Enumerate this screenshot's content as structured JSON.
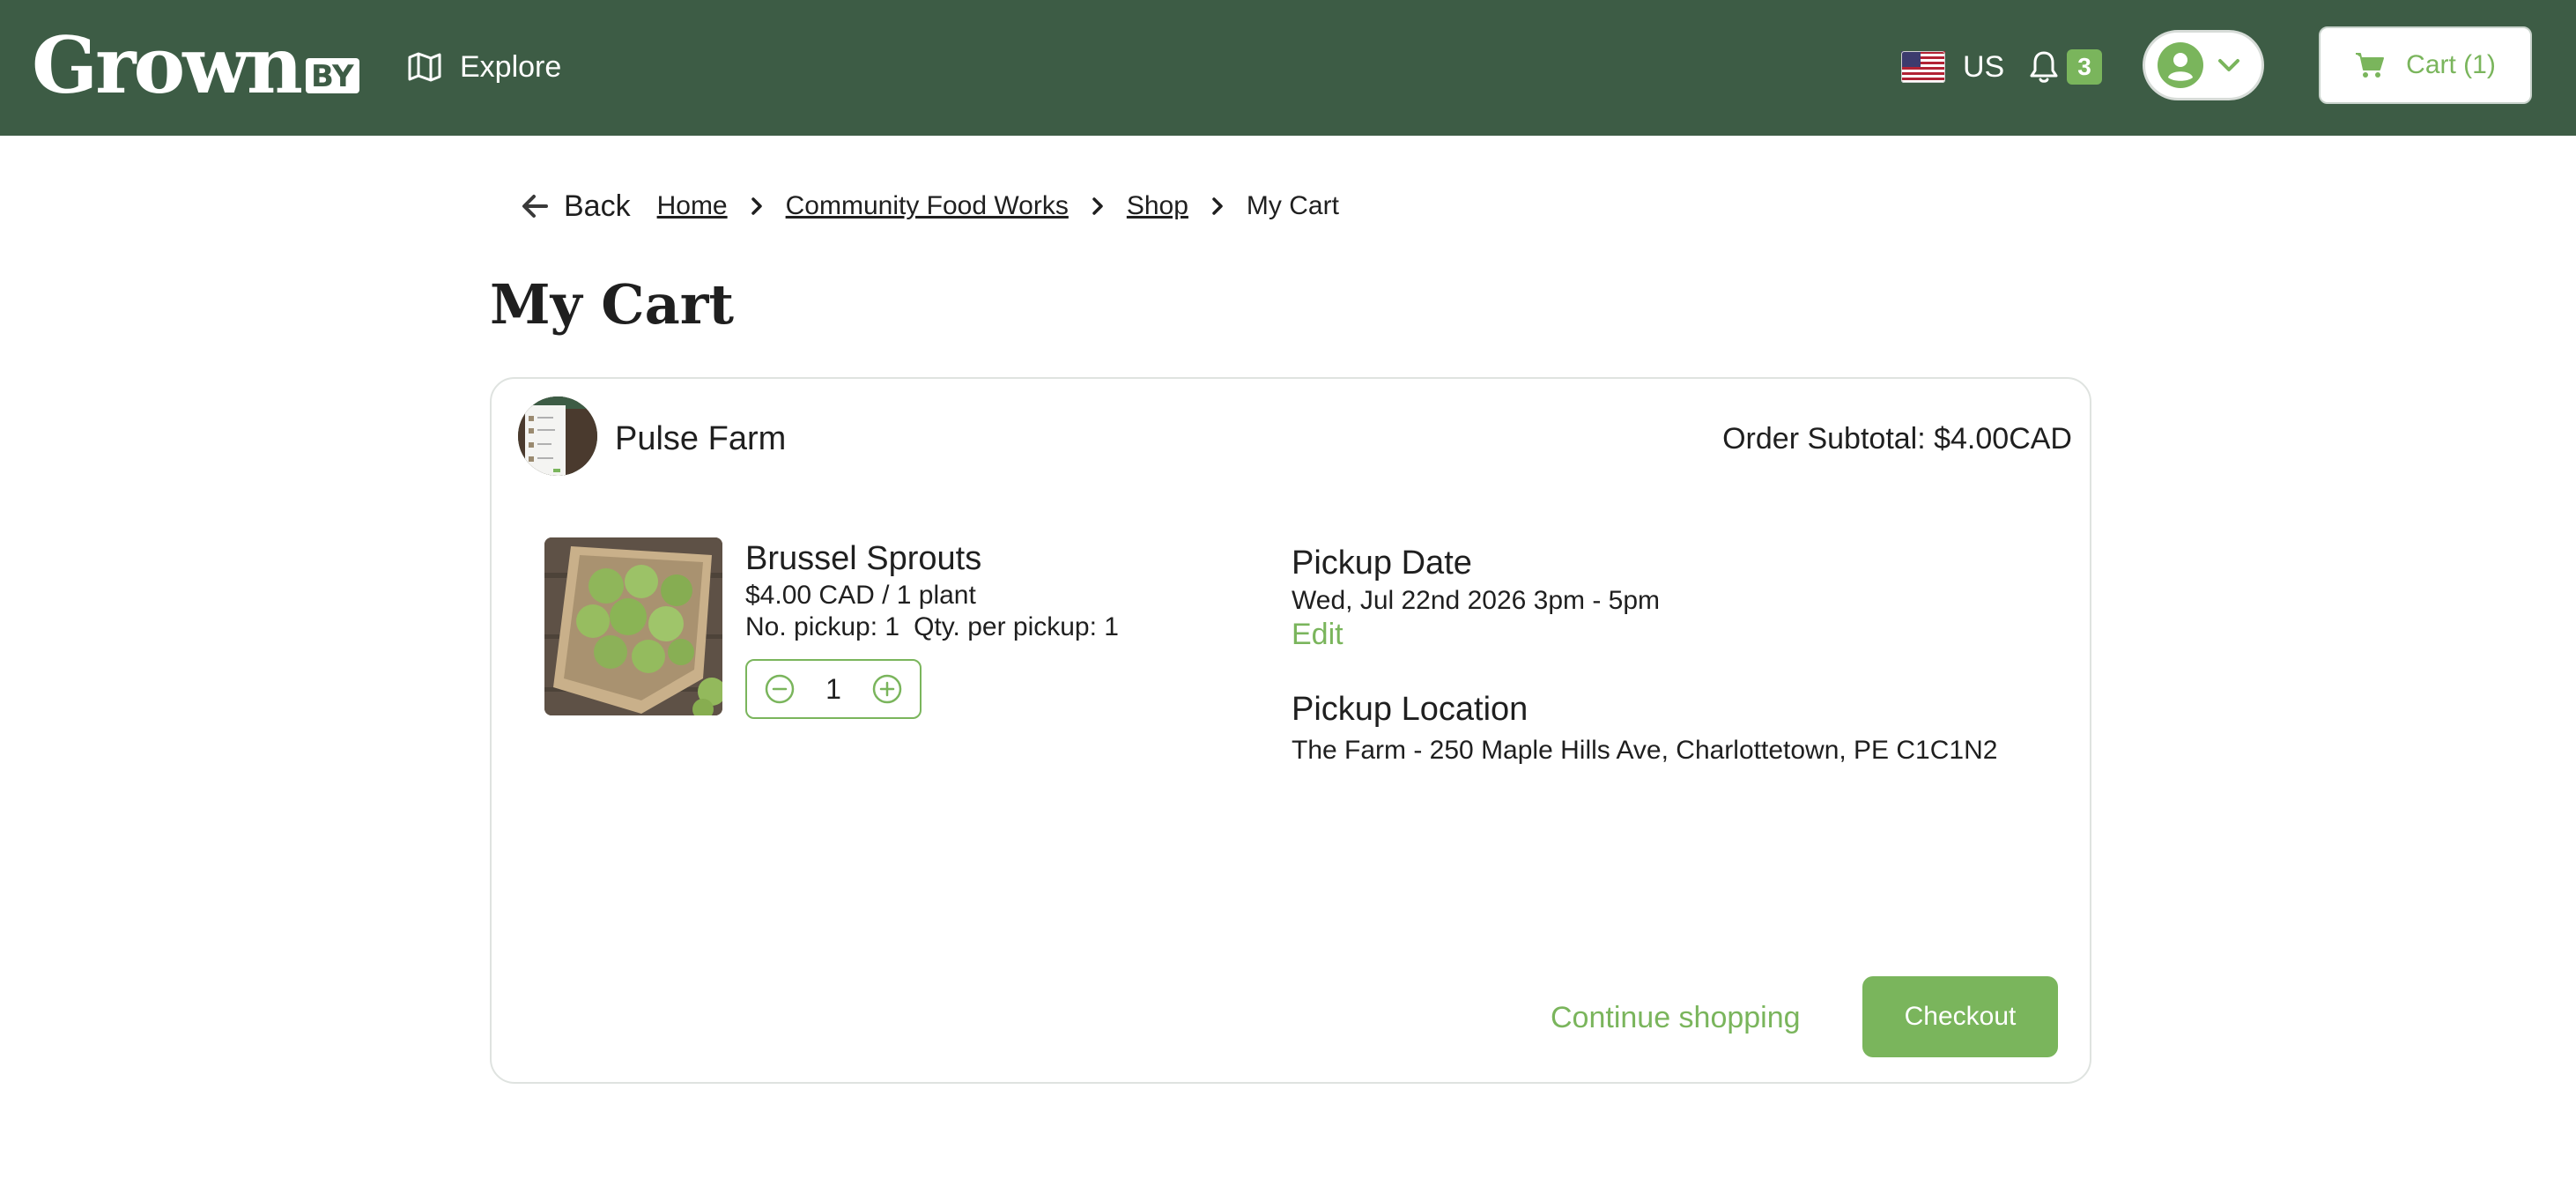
{
  "header": {
    "logo_text": "Grown",
    "logo_suffix": "BY",
    "explore_label": "Explore",
    "region_label": "US",
    "notification_count": "3",
    "cart_label": "Cart (1)",
    "brand_color": "#3d5c45",
    "accent_color": "#7ab55c"
  },
  "breadcrumb": {
    "back_label": "Back",
    "items": [
      "Home",
      "Community Food Works",
      "Shop"
    ],
    "current": "My Cart"
  },
  "page": {
    "title": "My Cart"
  },
  "cart": {
    "farm_name": "Pulse Farm",
    "subtotal": "Order Subtotal: $4.00CAD",
    "item": {
      "name": "Brussel Sprouts",
      "price": "$4.00 CAD / 1 plant",
      "pickups": "No. pickup: 1",
      "qty_per_pickup": "Qty. per pickup: 1",
      "quantity": "1"
    },
    "pickup_date": {
      "heading": "Pickup Date",
      "value": "Wed, Jul 22nd 2026 3pm - 5pm",
      "edit_label": "Edit"
    },
    "pickup_location": {
      "heading": "Pickup Location",
      "value": "The Farm - 250 Maple Hills Ave, Charlottetown, PE C1C1N2"
    },
    "continue_label": "Continue shopping",
    "checkout_label": "Checkout"
  },
  "icons": {
    "explore": "map-icon",
    "region": "us-flag-icon",
    "notifications": "bell-icon",
    "account": "user-avatar-icon",
    "account_menu": "chevron-down-icon",
    "cart": "cart-icon",
    "back": "arrow-left-icon",
    "crumb_separator": "chevron-right-icon",
    "decrement": "minus-circle-icon",
    "increment": "plus-circle-icon"
  }
}
